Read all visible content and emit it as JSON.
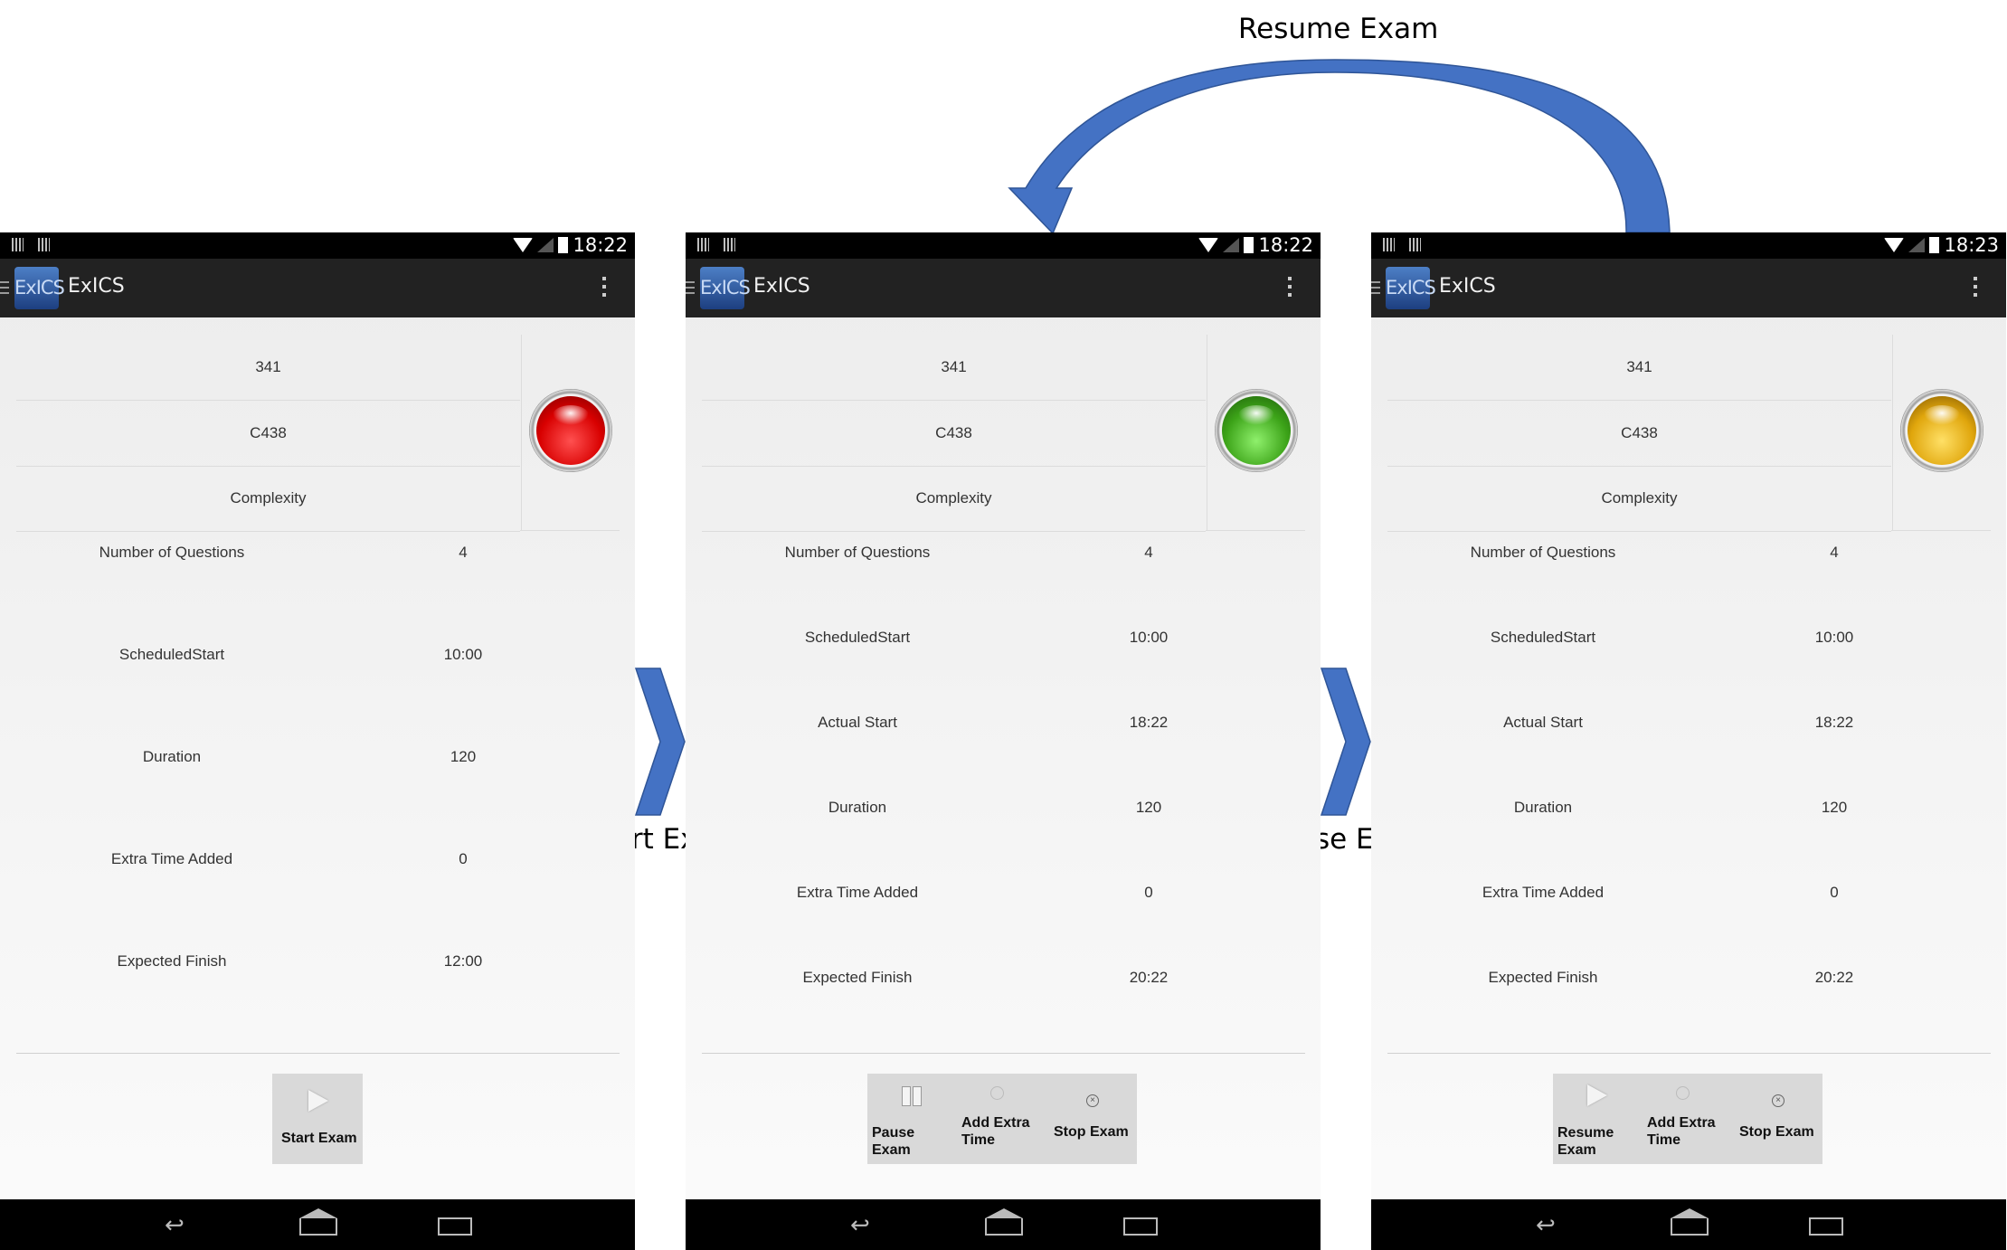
{
  "captions": {
    "resume": "Resume Exam",
    "start": "Start Exam",
    "pause": "Pause Exam"
  },
  "colors": {
    "arrow_blue": "#4472c4",
    "light_red": "#d80000",
    "light_green": "#3ca318",
    "light_amber": "#e0a60c"
  },
  "screens": [
    {
      "status_time": "18:22",
      "app_title": "ExICS",
      "logo_text": "ExICS",
      "top": [
        "341",
        "C438",
        "Complexity"
      ],
      "light": "red",
      "rows": [
        {
          "label": "Number of Questions",
          "value": "4"
        },
        {
          "label": "ScheduledStart",
          "value": "10:00"
        },
        {
          "label": "Duration",
          "value": "120"
        },
        {
          "label": "Extra Time Added",
          "value": "0"
        },
        {
          "label": "Expected Finish",
          "value": "12:00"
        }
      ],
      "buttons": [
        {
          "label": "Start Exam",
          "icon": "play-icon"
        }
      ]
    },
    {
      "status_time": "18:22",
      "app_title": "ExICS",
      "logo_text": "ExICS",
      "top": [
        "341",
        "C438",
        "Complexity"
      ],
      "light": "green",
      "rows": [
        {
          "label": "Number of Questions",
          "value": "4"
        },
        {
          "label": "ScheduledStart",
          "value": "10:00"
        },
        {
          "label": "Actual Start",
          "value": "18:22"
        },
        {
          "label": "Duration",
          "value": "120"
        },
        {
          "label": "Extra Time Added",
          "value": "0"
        },
        {
          "label": "Expected Finish",
          "value": "20:22"
        }
      ],
      "buttons": [
        {
          "label_l1": "Pause",
          "label_l2": "Exam",
          "icon": "pause-icon"
        },
        {
          "label_l1": "Add Extra",
          "label_l2": "Time",
          "icon": "alarm-clock-icon"
        },
        {
          "label": "Stop Exam",
          "icon": "stop-icon"
        }
      ]
    },
    {
      "status_time": "18:23",
      "app_title": "ExICS",
      "logo_text": "ExICS",
      "top": [
        "341",
        "C438",
        "Complexity"
      ],
      "light": "amber",
      "rows": [
        {
          "label": "Number of Questions",
          "value": "4"
        },
        {
          "label": "ScheduledStart",
          "value": "10:00"
        },
        {
          "label": "Actual Start",
          "value": "18:22"
        },
        {
          "label": "Duration",
          "value": "120"
        },
        {
          "label": "Extra Time Added",
          "value": "0"
        },
        {
          "label": "Expected Finish",
          "value": "20:22"
        }
      ],
      "buttons": [
        {
          "label_l1": "Resume",
          "label_l2": "Exam",
          "icon": "play-icon"
        },
        {
          "label_l1": "Add Extra",
          "label_l2": "Time",
          "icon": "alarm-clock-icon"
        },
        {
          "label": "Stop Exam",
          "icon": "stop-icon"
        }
      ]
    }
  ]
}
